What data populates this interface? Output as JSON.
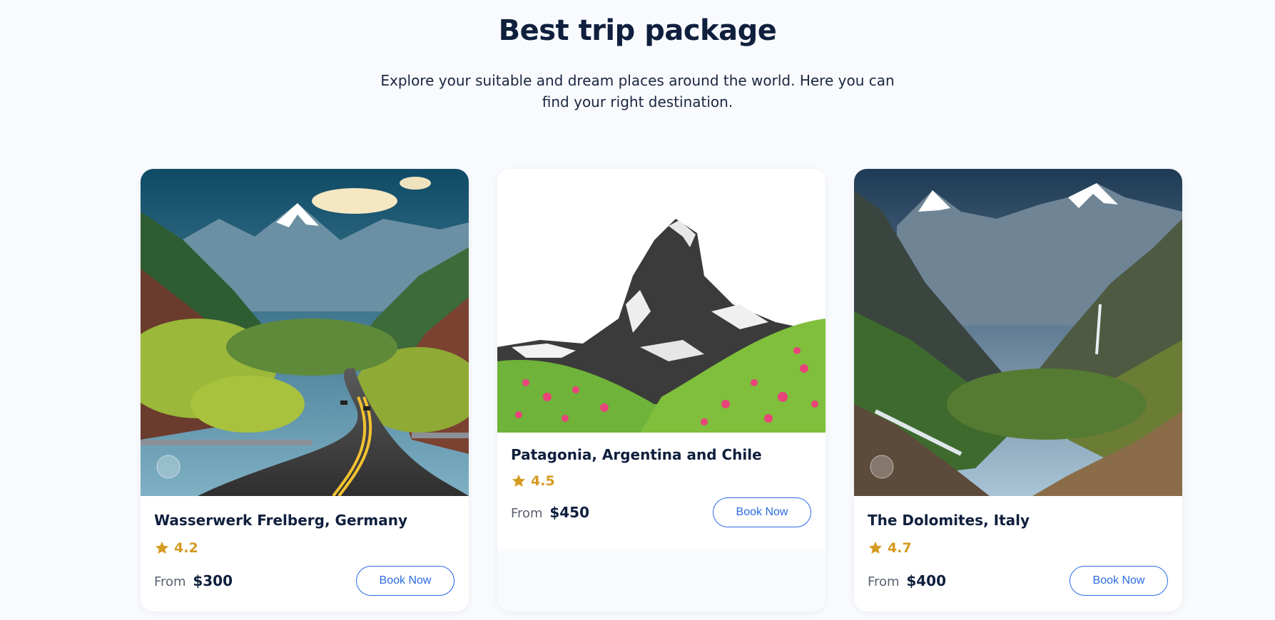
{
  "section": {
    "title": "Best trip package",
    "subtitle": "Explore your suitable and dream places around the world. Here you can find your right destination."
  },
  "packages": [
    {
      "name": "Wasserwerk Frelberg, Germany",
      "rating": "4.2",
      "price_prefix": "From",
      "price": "$300",
      "button_label": "Book Now",
      "image": "valley-road-photo"
    },
    {
      "name": "Patagonia, Argentina and Chile",
      "rating": "4.5",
      "price_prefix": "From",
      "price": "$450",
      "button_label": "Book Now",
      "image": "matterhorn-flowers-photo"
    },
    {
      "name": "The Dolomites, Italy",
      "rating": "4.7",
      "price_prefix": "From",
      "price": "$400",
      "button_label": "Book Now",
      "image": "alpine-valley-photo"
    }
  ],
  "colors": {
    "accent": "#2b6be3",
    "star": "#d59a20",
    "heading": "#0f1f3d",
    "background": "#f8fafd"
  }
}
